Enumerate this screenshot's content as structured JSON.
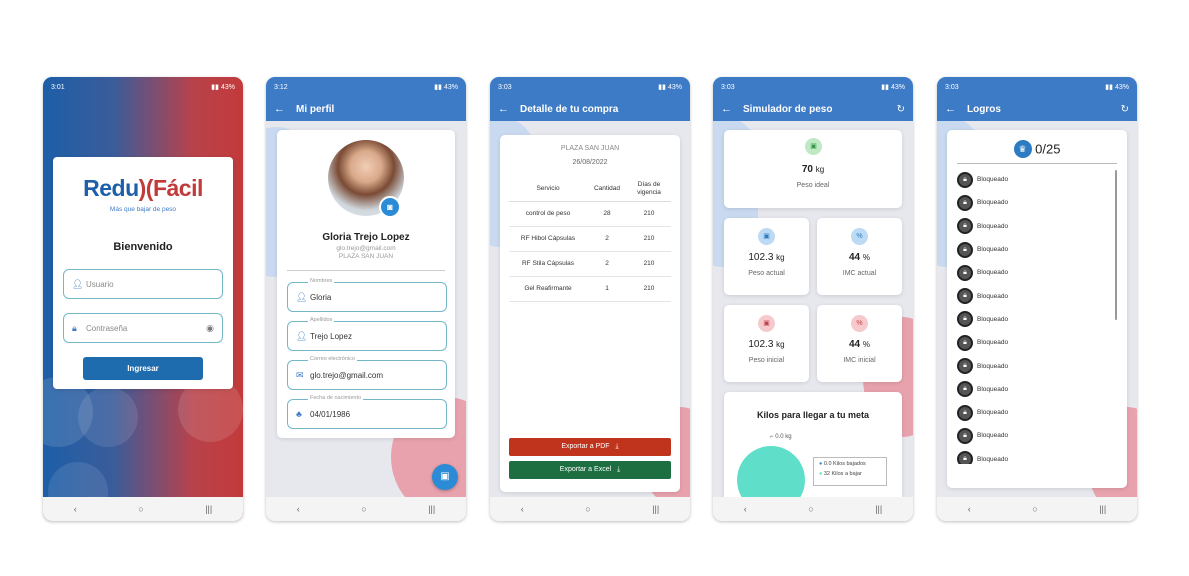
{
  "screens": {
    "login": {
      "status": {
        "time": "3:01",
        "right": "43%"
      },
      "logo_left": "Redu",
      "logo_right": "Fácil",
      "tagline": "Más que bajar de peso",
      "welcome": "Bienvenido",
      "user_placeholder": "Usuario",
      "password_placeholder": "Contraseña",
      "login_button": "Ingresar"
    },
    "profile": {
      "status": {
        "time": "3:12",
        "right": "43%"
      },
      "title": "Mi perfil",
      "name": "Gloria Trejo Lopez",
      "email_sub": "glo.trejo@gmail.com",
      "branch": "PLAZA SAN JUAN",
      "fields": [
        {
          "label": "Nombres",
          "value": "Gloria"
        },
        {
          "label": "Apellidos",
          "value": "Trejo Lopez"
        },
        {
          "label": "Correo electrónico",
          "value": "glo.trejo@gmail.com"
        },
        {
          "label": "Fecha de nacimiento",
          "value": "04/01/1986"
        }
      ]
    },
    "purchase": {
      "status": {
        "time": "3:03",
        "right": "43%"
      },
      "title": "Detalle de tu compra",
      "branch": "PLAZA SAN JUAN",
      "date": "26/08/2022",
      "columns": [
        "Servicio",
        "Cantidad",
        "Días de vigencia"
      ],
      "rows": [
        [
          "control de peso",
          "28",
          "210"
        ],
        [
          "RF Hibol Cápsulas",
          "2",
          "210"
        ],
        [
          "RF Stila Cápsulas",
          "2",
          "210"
        ],
        [
          "Gel Reafirmante",
          "1",
          "210"
        ]
      ],
      "pdf_button": "Exportar a PDF",
      "excel_button": "Exportar a Excel",
      "colors": {
        "pdf": "#c0341d",
        "excel": "#1d6f42"
      }
    },
    "simulator": {
      "status": {
        "time": "3:03",
        "right": "43%"
      },
      "title": "Simulador de peso",
      "ideal": {
        "value": "70",
        "unit": "kg",
        "label": "Peso ideal"
      },
      "current": {
        "value": "102.3",
        "unit": "kg",
        "label": "Peso actual"
      },
      "imc_current": {
        "value": "44",
        "unit": "%",
        "label": "IMC actual"
      },
      "initial": {
        "value": "102.3",
        "unit": "kg",
        "label": "Peso inicial"
      },
      "imc_initial": {
        "value": "44",
        "unit": "%",
        "label": "IMC inicial"
      },
      "goal_title": "Kilos para llegar a tu meta",
      "goal_marker": "0.0 kg",
      "legend": [
        "0.0 Kilos bajados",
        "32 Kilos a bajar"
      ]
    },
    "achievements": {
      "status": {
        "time": "3:03",
        "right": "43%"
      },
      "title": "Logros",
      "count": "0/25",
      "item_label": "Bloqueado",
      "items": [
        "Bloqueado",
        "Bloqueado",
        "Bloqueado",
        "Bloqueado",
        "Bloqueado",
        "Bloqueado",
        "Bloqueado",
        "Bloqueado",
        "Bloqueado",
        "Bloqueado",
        "Bloqueado",
        "Bloqueado",
        "Bloqueado"
      ]
    }
  }
}
